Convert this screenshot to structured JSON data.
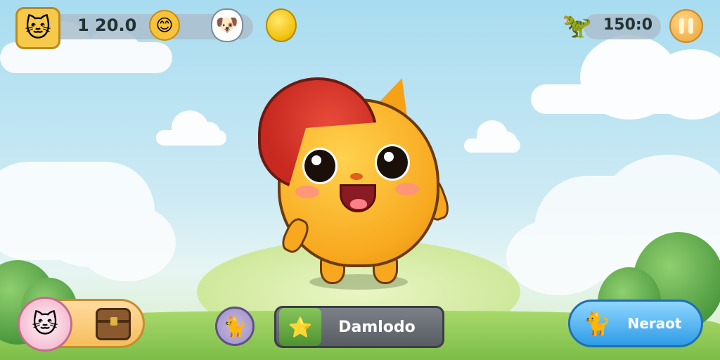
{
  "hud": {
    "score": "1 20.0",
    "score_secondary": "150:0",
    "player_avatar_icon": "cat-face-icon",
    "emotion_icon": "smiley-face-icon",
    "pet_icon": "white-dog-icon",
    "currency_icon": "gold-coin-icon",
    "creature_icon": "green-dino-icon",
    "pause_icon": "pause-icon"
  },
  "bottom": {
    "left_cat_icon": "cat-face-icon",
    "chest_icon": "treasure-chest-icon",
    "grey_cat_icon": "grey-cat-icon",
    "middle_button_label": "Damlodo",
    "middle_button_icon": "star-cat-icon",
    "right_button_label": "Neraot",
    "right_button_icon": "running-cat-icon"
  },
  "colors": {
    "sky": "#a8dcf0",
    "ground": "#7cbd48",
    "character": "#f7a81e",
    "hat": "#c7281f",
    "middle_button": "#585c63",
    "right_button": "#2f9ce6"
  }
}
